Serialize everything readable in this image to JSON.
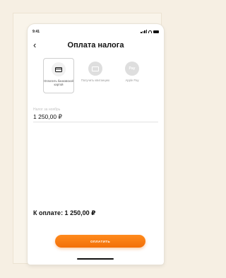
{
  "status_bar": {
    "time": "9:41"
  },
  "header": {
    "title": "Оплата налога",
    "back_glyph": "‹"
  },
  "payment_options": [
    {
      "label": "Оплатить банковской картой",
      "icon": "card-icon",
      "selected": true
    },
    {
      "label": "Получить квитанцию",
      "icon": "receipt-icon",
      "selected": false
    },
    {
      "label": "Apple Pay",
      "icon": "apple-pay-icon",
      "selected": false,
      "icon_text": "Pay"
    }
  ],
  "amount_field": {
    "label": "Налог за ноябрь",
    "value": "1 250,00 ₽"
  },
  "total": {
    "text": "К оплате: 1 250,00 ₽"
  },
  "pay_button": {
    "label": "ОПЛАТИТЬ"
  },
  "colors": {
    "accent": "#f2700a",
    "background": "#f6efe3"
  }
}
